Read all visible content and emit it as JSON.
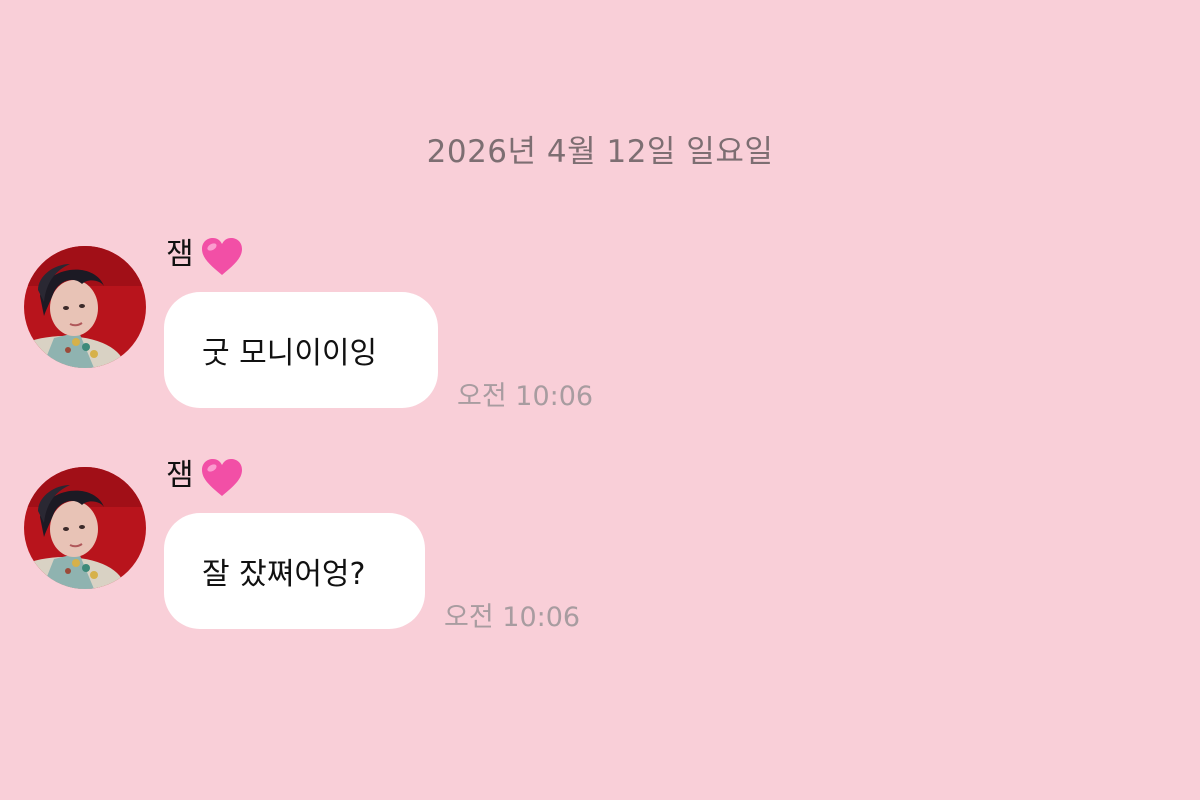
{
  "chat": {
    "date_divider": "2026년 4월 12일 일요일",
    "messages": [
      {
        "sender": "잼",
        "sender_emoji": "pink-heart",
        "avatar": "sender-avatar",
        "text": "굿 모니이이잉",
        "time": "오전 10:06"
      },
      {
        "sender": "잼",
        "sender_emoji": "pink-heart",
        "avatar": "sender-avatar",
        "text": "잘 잤쪄어엉?",
        "time": "오전 10:06"
      }
    ]
  },
  "colors": {
    "background": "#f9cfd8",
    "bubble": "#ffffff",
    "date_text": "#7d6e72",
    "timestamp_text": "#a89ca0",
    "heart": "#f24fa6"
  }
}
